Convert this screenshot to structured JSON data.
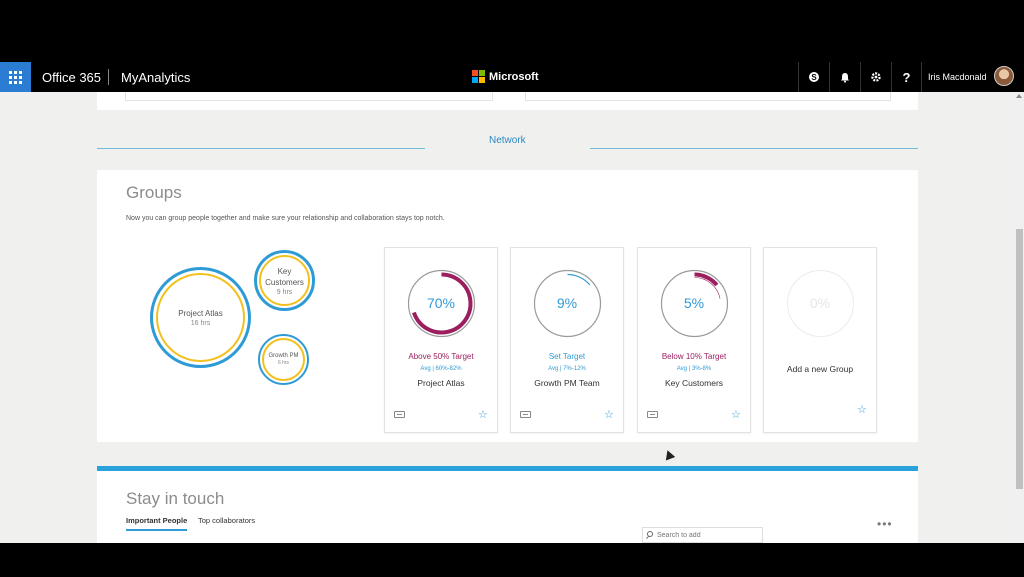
{
  "suite_bar": {
    "app_launcher": "app-launcher",
    "product": "Office 365",
    "app": "MyAnalytics",
    "brand": "Microsoft",
    "icons": [
      "skype-icon",
      "bell-icon",
      "gear-icon",
      "help-icon"
    ],
    "help_label": "?",
    "user_name": "Iris Macdonald",
    "accent": "#2b7cd3"
  },
  "network": {
    "label": "Network"
  },
  "groups": {
    "title": "Groups",
    "description": "Now you can group people together and make sure your relationship and collaboration stays top notch.",
    "bubbles": [
      {
        "name": "Project Atlas",
        "hours": "16 hrs"
      },
      {
        "name": "Key Customers",
        "hours": "9 hrs"
      },
      {
        "name": "Growth PM",
        "hours": "6 hrs"
      }
    ],
    "cards": [
      {
        "percent": "70%",
        "fill": 0.7,
        "status": "Above 50% Target",
        "status_color": "#9b1f5e",
        "avg": "Avg | 60%-82%",
        "name": "Project Atlas"
      },
      {
        "percent": "9%",
        "fill": 0.09,
        "status": "Set Target",
        "status_color": "#2f9bd6",
        "avg": "Avg | 7%-12%",
        "name": "Growth PM Team"
      },
      {
        "percent": "5%",
        "fill": 0.05,
        "status": "Below 10% Target",
        "status_color": "#9b1f5e",
        "avg": "Avg | 3%-8%",
        "name": "Key Customers"
      }
    ],
    "add_card": {
      "percent": "0%",
      "label": "Add a new Group"
    },
    "colors": {
      "ring_blue": "#2f9bd6",
      "ring_yellow": "#f2c01f",
      "magenta": "#9b1f5e"
    }
  },
  "stay_in_touch": {
    "title": "Stay in touch",
    "tabs": [
      "Important People",
      "Top collaborators"
    ],
    "search_placeholder": "Search to add",
    "more": "•••"
  }
}
